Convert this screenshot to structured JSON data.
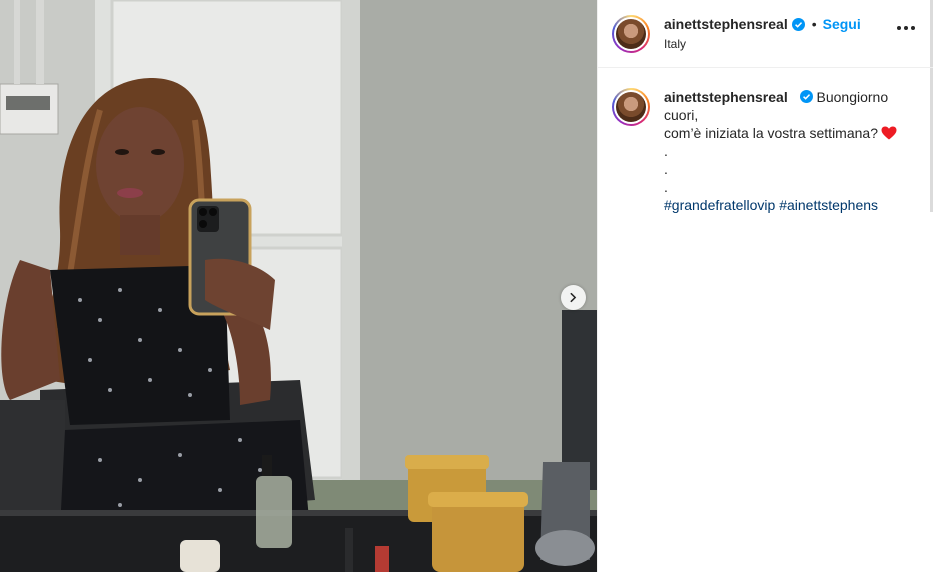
{
  "post": {
    "username": "ainettstephensreal",
    "follow_label": "Segui",
    "separator": "•",
    "location": "Italy",
    "caption": {
      "line1": "Buongiorno cuori,",
      "line2": "com’è iniziata la vostra settimana?",
      "heart_icon": "red-heart-emoji",
      "dots": [
        ".",
        ".",
        "."
      ],
      "hashtags": [
        "#grandefratellovip",
        "#ainettstephens"
      ]
    }
  },
  "icons": {
    "verified": "verified-badge-icon",
    "more": "more-options-icon",
    "next": "chevron-right-icon"
  },
  "colors": {
    "follow": "#0095f6",
    "verified": "#0095f6",
    "hashtag": "#00376b",
    "heart": "#ed1c24"
  }
}
